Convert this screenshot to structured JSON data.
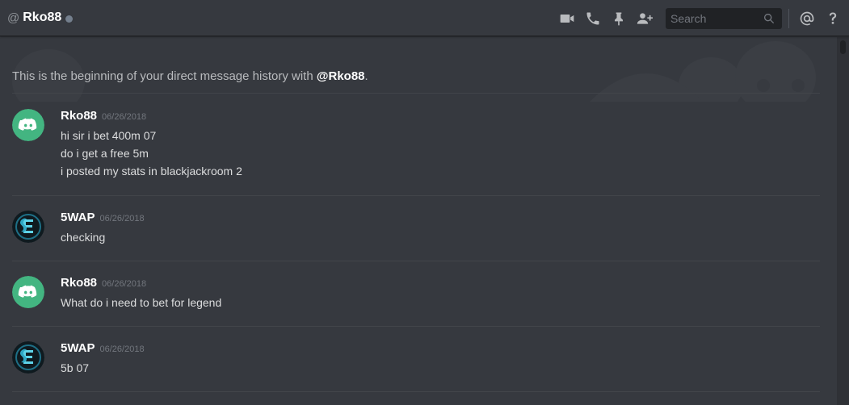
{
  "header": {
    "at": "@",
    "name": "Rko88",
    "search_placeholder": "Search",
    "icons": [
      "video-call-icon",
      "voice-call-icon",
      "pin-icon",
      "add-friend-icon",
      "search-icon",
      "mention-icon",
      "help-icon"
    ]
  },
  "intro": {
    "prefix": "This is the beginning of your direct message history with ",
    "handle": "@Rko88",
    "suffix": "."
  },
  "messages": [
    {
      "author": "Rko88",
      "timestamp": "06/26/2018",
      "avatar": "discord-default",
      "lines": [
        "hi sir i bet 400m 07",
        "do i get a free 5m",
        "i posted my stats in blackjackroom 2"
      ]
    },
    {
      "author": "5WAP",
      "timestamp": "06/26/2018",
      "avatar": "5wap-logo",
      "lines": [
        "checking"
      ]
    },
    {
      "author": "Rko88",
      "timestamp": "06/26/2018",
      "avatar": "discord-default",
      "lines": [
        "What do i need to bet for legend"
      ]
    },
    {
      "author": "5WAP",
      "timestamp": "06/26/2018",
      "avatar": "5wap-logo",
      "lines": [
        "5b 07"
      ]
    }
  ],
  "colors": {
    "background": "#36393f",
    "header_text": "#ffffff",
    "avatar_green": "#43b581",
    "status_offline": "#747f8d"
  }
}
